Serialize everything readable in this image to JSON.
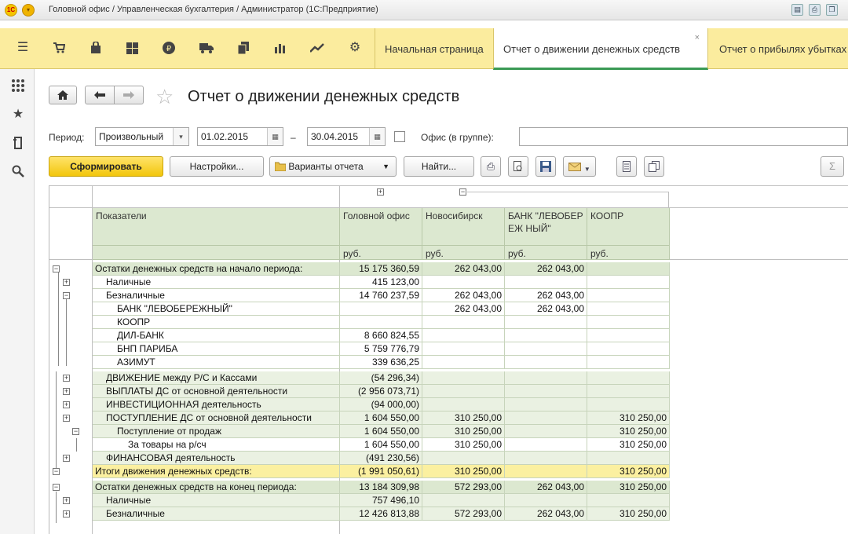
{
  "window": {
    "title": "Головной офис / Управленческая бухгалтерия / Администратор  (1С:Предприятие)",
    "logo_text": "1С"
  },
  "toolbar": {
    "icons": [
      "menu-icon",
      "cart-icon",
      "shopping-bag-icon",
      "grid-icon",
      "ruble-icon",
      "truck-icon",
      "documents-icon",
      "bar-chart-icon",
      "trend-icon",
      "gear-icon"
    ],
    "tabs": [
      {
        "label": "Начальная страница",
        "active": false
      },
      {
        "label": "Отчет о движении денежных средств",
        "active": true,
        "close": "×"
      },
      {
        "label": "Отчет о прибылях убытках",
        "active": false
      }
    ]
  },
  "header": {
    "title": "Отчет о движении денежных средств"
  },
  "filters": {
    "period_label": "Период:",
    "period_type": "Произвольный",
    "date_from": "01.02.2015",
    "dash": "–",
    "date_to": "30.04.2015",
    "office_label": "Офис (в группе):",
    "office_value": ""
  },
  "actions": {
    "generate": "Сформировать",
    "settings": "Настройки...",
    "variants": "Варианты отчета",
    "find": "Найти...",
    "sum": "Σ"
  },
  "report": {
    "columns": [
      {
        "name": "Показатели",
        "unit": ""
      },
      {
        "name": "Головной офис",
        "unit": "руб."
      },
      {
        "name": "Новосибирск",
        "unit": "руб."
      },
      {
        "name": "БАНК \"ЛЕВОБЕРЕЖ НЫЙ\"",
        "unit": "руб."
      },
      {
        "name": "КООПР",
        "unit": "руб."
      }
    ],
    "rows": [
      {
        "label": "Остатки денежных средств на начало периода:",
        "values": [
          "15 175 360,59",
          "262 043,00",
          "262 043,00",
          ""
        ]
      },
      {
        "label": "Наличные",
        "values": [
          "415 123,00",
          "",
          "",
          ""
        ]
      },
      {
        "label": "Безналичные",
        "values": [
          "14 760 237,59",
          "262 043,00",
          "262 043,00",
          ""
        ]
      },
      {
        "label": "БАНК \"ЛЕВОБЕРЕЖНЫЙ\"",
        "values": [
          "",
          "262 043,00",
          "262 043,00",
          ""
        ]
      },
      {
        "label": "КООПР",
        "values": [
          "",
          "",
          "",
          ""
        ]
      },
      {
        "label": "ДИЛ-БАНК",
        "values": [
          "8 660 824,55",
          "",
          "",
          ""
        ]
      },
      {
        "label": "БНП ПАРИБА",
        "values": [
          "5 759 776,79",
          "",
          "",
          ""
        ]
      },
      {
        "label": "АЗИМУТ",
        "values": [
          "339 636,25",
          "",
          "",
          ""
        ]
      },
      {
        "label": "ДВИЖЕНИЕ между Р/С и Кассами",
        "values": [
          "(54 296,34)",
          "",
          "",
          ""
        ]
      },
      {
        "label": "ВЫПЛАТЫ ДС от основной деятельности",
        "values": [
          "(2 956 073,71)",
          "",
          "",
          ""
        ]
      },
      {
        "label": "ИНВЕСТИЦИОННАЯ деятельность",
        "values": [
          "(94 000,00)",
          "",
          "",
          ""
        ]
      },
      {
        "label": "ПОСТУПЛЕНИЕ ДС от основной деятельности",
        "values": [
          "1 604 550,00",
          "310 250,00",
          "",
          "310 250,00"
        ]
      },
      {
        "label": "Поступление от продаж",
        "values": [
          "1 604 550,00",
          "310 250,00",
          "",
          "310 250,00"
        ]
      },
      {
        "label": "За товары на р/сч",
        "values": [
          "1 604 550,00",
          "310 250,00",
          "",
          "310 250,00"
        ]
      },
      {
        "label": "ФИНАНСОВАЯ деятельность",
        "values": [
          "(491 230,56)",
          "",
          "",
          ""
        ]
      },
      {
        "label": "Итоги движения денежных средств:",
        "values": [
          "(1 991 050,61)",
          "310 250,00",
          "",
          "310 250,00"
        ]
      },
      {
        "label": "Остатки денежных средств на конец периода:",
        "values": [
          "13 184 309,98",
          "572 293,00",
          "262 043,00",
          "310 250,00"
        ]
      },
      {
        "label": "Наличные",
        "values": [
          "757 496,10",
          "",
          "",
          ""
        ]
      },
      {
        "label": "Безналичные",
        "values": [
          "12 426 813,88",
          "572 293,00",
          "262 043,00",
          "310 250,00"
        ]
      }
    ]
  }
}
